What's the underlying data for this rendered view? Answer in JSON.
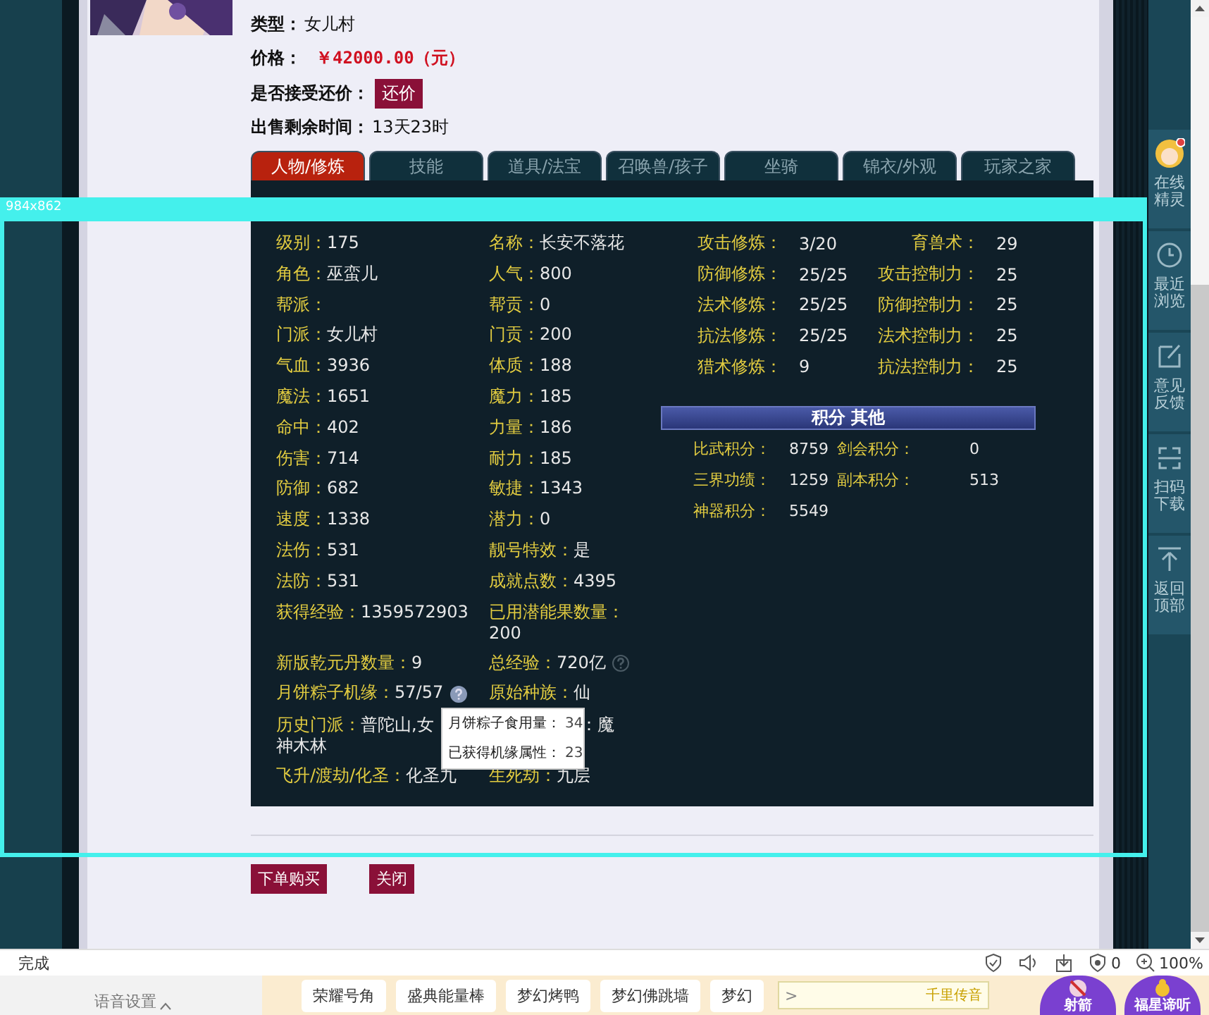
{
  "listing": [
    {
      "label": "类型：",
      "value": "女儿村",
      "kind": "text"
    },
    {
      "label": "价格：",
      "value": "￥42000.00（元）",
      "kind": "price"
    },
    {
      "label": "是否接受还价：",
      "value": "还价",
      "kind": "button"
    },
    {
      "label": "出售剩余时间：",
      "value": "13天23时",
      "kind": "text"
    }
  ],
  "tabs": [
    {
      "label": "人物/修炼",
      "selected": true
    },
    {
      "label": "技能",
      "selected": false
    },
    {
      "label": "道具/法宝",
      "selected": false
    },
    {
      "label": "召唤兽/孩子",
      "selected": false
    },
    {
      "label": "坐骑",
      "selected": false
    },
    {
      "label": "锦衣/外观",
      "selected": false
    },
    {
      "label": "玩家之家",
      "selected": false
    }
  ],
  "stats": [
    {
      "label": "级别：",
      "value": "175"
    },
    {
      "label": "名称：",
      "value": "长安不落花"
    },
    {
      "label": "角色：",
      "value": "巫蛮儿"
    },
    {
      "label": "人气：",
      "value": "800"
    },
    {
      "label": "帮派："
    },
    {
      "label": "帮贡：",
      "value": "0"
    },
    {
      "label": "门派：",
      "value": "女儿村"
    },
    {
      "label": "门贡：",
      "value": "200"
    },
    {
      "label": "气血：",
      "value": "3936"
    },
    {
      "label": "体质：",
      "value": "188"
    },
    {
      "label": "魔法：",
      "value": "1651"
    },
    {
      "label": "魔力：",
      "value": "185"
    },
    {
      "label": "命中：",
      "value": "402"
    },
    {
      "label": "力量：",
      "value": "186"
    },
    {
      "label": "伤害：",
      "value": "714"
    },
    {
      "label": "耐力：",
      "value": "185"
    },
    {
      "label": "防御：",
      "value": "682"
    },
    {
      "label": "敏捷：",
      "value": "1343"
    },
    {
      "label": "速度：",
      "value": "1338"
    },
    {
      "label": "潜力：",
      "value": "0"
    },
    {
      "label": "法伤：",
      "value": "531"
    },
    {
      "label": "靓号特效：",
      "value": "是"
    },
    {
      "label": "法防：",
      "value": "531"
    },
    {
      "label": "成就点数：",
      "value": "4395"
    },
    {
      "label": "获得经验：",
      "value": "1359572903"
    },
    {
      "label": "已用潜能果数量：",
      "value": "200"
    },
    {
      "label": "新版乾元丹数量：",
      "value": "9"
    },
    {
      "label": "总经验：",
      "value": "720亿",
      "help": true
    },
    {
      "label": "月饼粽子机缘：",
      "value": "57/57",
      "help": true
    },
    {
      "label": "原始种族：",
      "value": "仙"
    }
  ],
  "history": {
    "label": "历史门派：",
    "value_start": "普陀山,女",
    "value_end": "：魔",
    "value_wrap": "神木林"
  },
  "ascension": [
    {
      "label": "飞升/渡劫/化圣：",
      "value": "化圣九"
    },
    {
      "label": "生死劫：",
      "value": "九层"
    }
  ],
  "tooltip": [
    {
      "label": "月饼粽子食用量：",
      "value": "34"
    },
    {
      "label": "已获得机缘属性：",
      "value": "23"
    }
  ],
  "cultivation": [
    {
      "label": "攻击修炼：",
      "value": "3/20"
    },
    {
      "label": "育兽术：",
      "value": "29"
    },
    {
      "label": "防御修炼：",
      "value": "25/25"
    },
    {
      "label": "攻击控制力：",
      "value": "25"
    },
    {
      "label": "法术修炼：",
      "value": "25/25"
    },
    {
      "label": "防御控制力：",
      "value": "25"
    },
    {
      "label": "抗法修炼：",
      "value": "25/25"
    },
    {
      "label": "法术控制力：",
      "value": "25"
    },
    {
      "label": "猎术修炼：",
      "value": "9"
    },
    {
      "label": "抗法控制力：",
      "value": "25"
    }
  ],
  "scores_title": "积分 其他",
  "scores": [
    {
      "label": "比武积分：",
      "value": "8759"
    },
    {
      "label": "剑会积分：",
      "value": "0"
    },
    {
      "label": "三界功绩：",
      "value": "1259"
    },
    {
      "label": "副本积分：",
      "value": "513"
    },
    {
      "label": "神器积分：",
      "value": "5549"
    }
  ],
  "actions": [
    "下单购买",
    "关闭"
  ],
  "capture_frame": {
    "size_label": "984x862"
  },
  "sidebar": {
    "items": [
      {
        "label": "在线精灵",
        "kind": "avatar"
      },
      {
        "label": "最近浏览",
        "kind": "clock"
      },
      {
        "label": "意见反馈",
        "kind": "edit"
      },
      {
        "label": "扫码下载",
        "kind": "scan"
      },
      {
        "label": "返回顶部",
        "kind": "top"
      }
    ]
  },
  "status_bar": {
    "text": "完成",
    "counter": "0",
    "zoom": "100%"
  },
  "taskbar": {
    "voice_settings": "语音设置",
    "gifts": [
      "荣耀号角",
      "盛典能量棒",
      "梦幻烤鸭",
      "梦幻佛跳墙",
      "梦幻"
    ],
    "chat_input": {
      "placeholder": ">"
    },
    "chat_button": "千里传音",
    "activities": [
      {
        "label": "射箭"
      },
      {
        "label": "福星谛听"
      }
    ]
  }
}
